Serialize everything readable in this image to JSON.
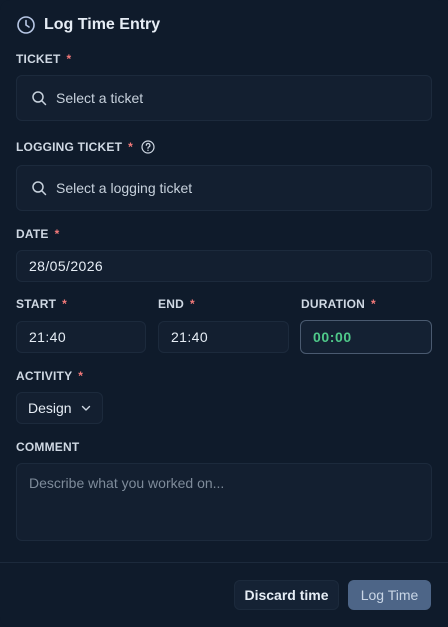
{
  "header": {
    "title": "Log Time Entry",
    "icon": "clock-icon"
  },
  "ticket": {
    "label": "TICKET",
    "required": "*",
    "placeholder": "Select a ticket"
  },
  "logging_ticket": {
    "label": "LOGGING TICKET",
    "required": "*",
    "placeholder": "Select a logging ticket"
  },
  "date": {
    "label": "DATE",
    "required": "*",
    "value": "28/05/2026"
  },
  "start": {
    "label": "START",
    "required": "*",
    "value": "21:40"
  },
  "end": {
    "label": "END",
    "required": "*",
    "value": "21:40"
  },
  "duration": {
    "label": "DURATION",
    "required": "*",
    "value": "00:00"
  },
  "activity": {
    "label": "ACTIVITY",
    "required": "*",
    "value": "Design"
  },
  "comment": {
    "label": "COMMENT",
    "placeholder": "Describe what you worked on..."
  },
  "footer": {
    "discard_label": "Discard time",
    "submit_label": "Log Time"
  },
  "colors": {
    "background": "#0f1b2b",
    "required": "#f47a7a",
    "duration": "#4fc98a",
    "primary_button": "#4d6587"
  }
}
